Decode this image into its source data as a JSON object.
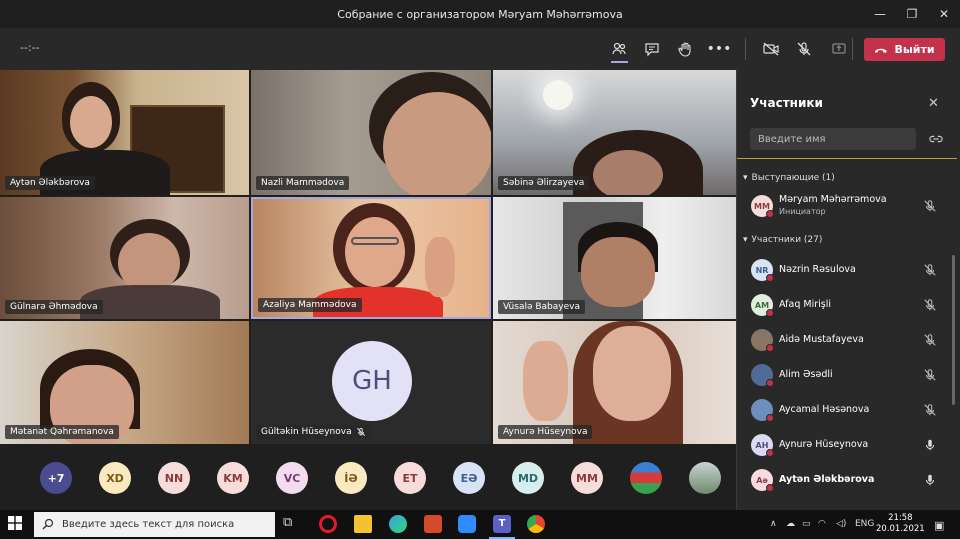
{
  "window": {
    "title": "Собрание с организатором Məryam Məhərrəmova"
  },
  "toolbar": {
    "timer": "--:--",
    "leave_label": "Выйти"
  },
  "tiles": [
    {
      "name": "Aytən Ələkbərova"
    },
    {
      "name": "Nazli Mammədova"
    },
    {
      "name": "Səbinə Əlirzayeva"
    },
    {
      "name": "Gülnarə Əhmədova"
    },
    {
      "name": "Azaliya Mammədova"
    },
    {
      "name": "Vüsalə Babayeva"
    },
    {
      "name": "Mətanət Qəhrəmanova"
    },
    {
      "name": "Gültəkin Hüseynova",
      "initials": "GH"
    },
    {
      "name": "Aynurə Hüseynova"
    }
  ],
  "strip": {
    "overflow": "+7",
    "avatars": [
      "XD",
      "NN",
      "KM",
      "VC",
      "İƏ",
      "ET",
      "EƏ",
      "MD",
      "MM"
    ]
  },
  "panel": {
    "title": "Участники",
    "search_placeholder": "Введите имя",
    "presenters_header": "Выступающие (1)",
    "attendees_header": "Участники (27)",
    "presenter": {
      "initials": "MM",
      "name": "Məryam Məhərrəmova",
      "role": "Инициатор"
    },
    "attendees": [
      {
        "initials": "NR",
        "name": "Nəzrin Rəsulova",
        "color": "#d8e3f5",
        "text": "#3c5f8f"
      },
      {
        "initials": "AM",
        "name": "Afaq Mirişli",
        "color": "#dfeede",
        "text": "#3f6b3c"
      },
      {
        "initials": "",
        "name": "Aidə Mustafayeva",
        "color": "#8a7565",
        "text": "#fff"
      },
      {
        "initials": "",
        "name": "Alim Əsədli",
        "color": "#4f6c96",
        "text": "#fff"
      },
      {
        "initials": "",
        "name": "Aycamal Həsənova",
        "color": "#6d8fbf",
        "text": "#fff"
      },
      {
        "initials": "AH",
        "name": "Aynurə Hüseynova",
        "color": "#dcdaf3",
        "text": "#4f4d7a"
      },
      {
        "initials": "Aə",
        "name": "Aytən Ələkbərova",
        "color": "#f6dbe0",
        "text": "#8a3c4f"
      }
    ]
  },
  "taskbar": {
    "search_placeholder": "Введите здесь текст для поиска",
    "lang": "ENG",
    "time": "21:58",
    "date": "20.01.2021"
  }
}
